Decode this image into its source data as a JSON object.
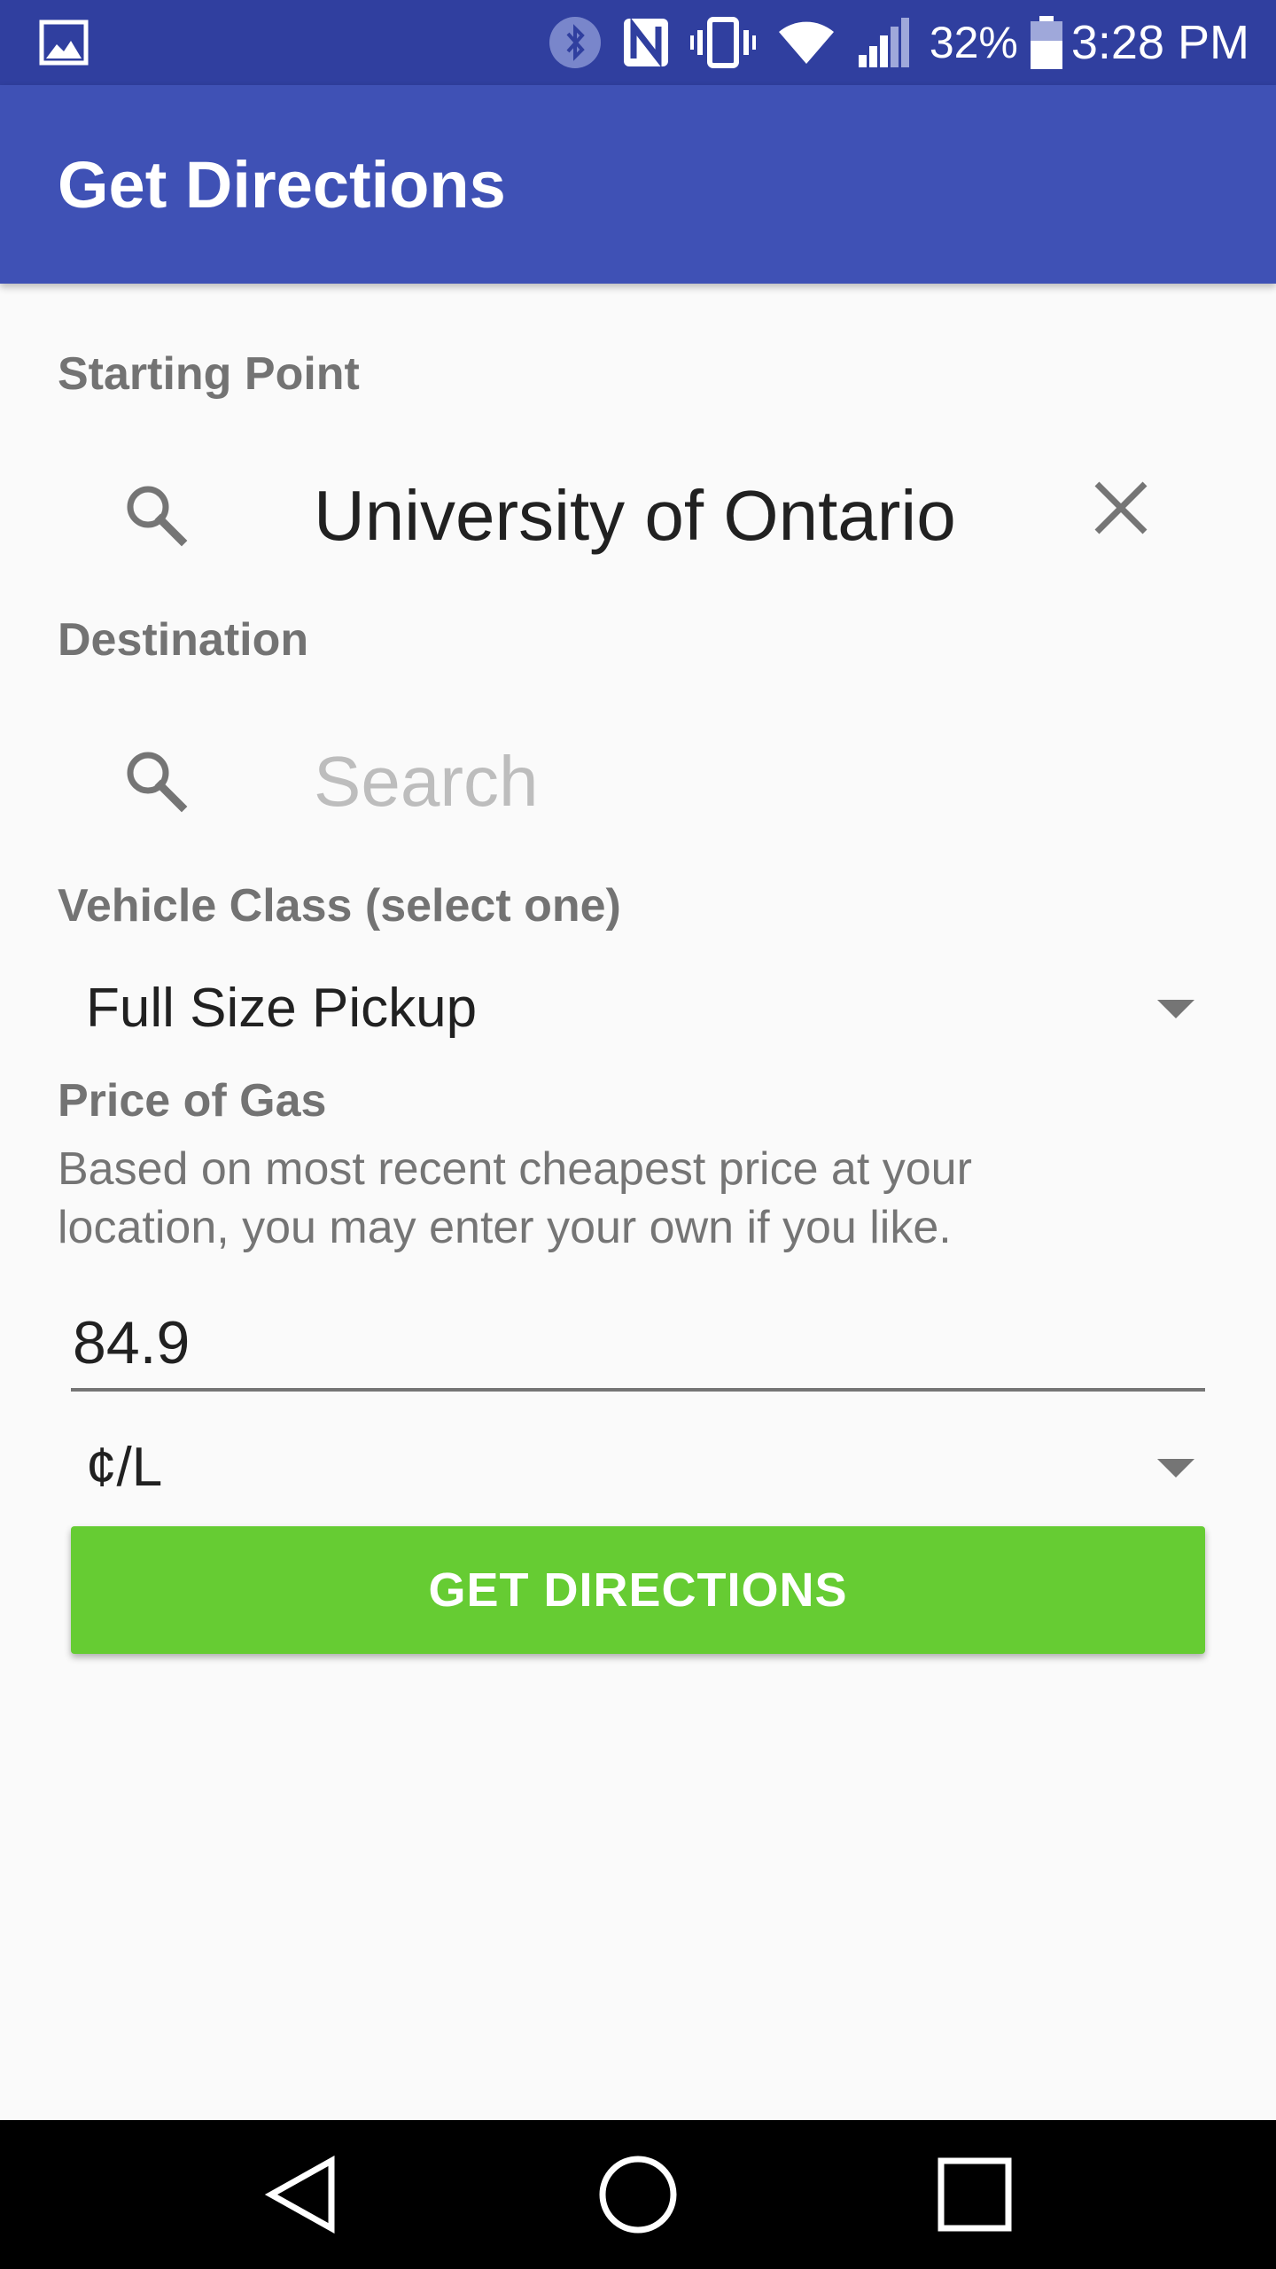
{
  "status_bar": {
    "battery_percent": "32%",
    "time": "3:28 PM",
    "icons": [
      "gallery-icon",
      "bluetooth-icon",
      "nfc-icon",
      "vibrate-icon",
      "wifi-icon",
      "signal-icon",
      "battery-icon"
    ]
  },
  "app_bar": {
    "title": "Get Directions"
  },
  "form": {
    "starting_point": {
      "label": "Starting Point",
      "value": "University of Ontario"
    },
    "destination": {
      "label": "Destination",
      "placeholder": "Search",
      "value": ""
    },
    "vehicle_class": {
      "label": "Vehicle Class (select one)",
      "selected": "Full Size Pickup"
    },
    "gas": {
      "label": "Price of Gas",
      "helper": "Based on most recent cheapest price at your location, you may enter your own if you like.",
      "value": "84.9",
      "unit_selected": "¢/L"
    },
    "submit_label": "GET DIRECTIONS",
    "accent_color": "#66cc33"
  },
  "colors": {
    "status_bar": "#303f9f",
    "app_bar": "#3f51b5",
    "background": "#fafafa"
  },
  "nav_bar": {
    "buttons": [
      "back-icon",
      "home-icon",
      "recents-icon"
    ]
  }
}
